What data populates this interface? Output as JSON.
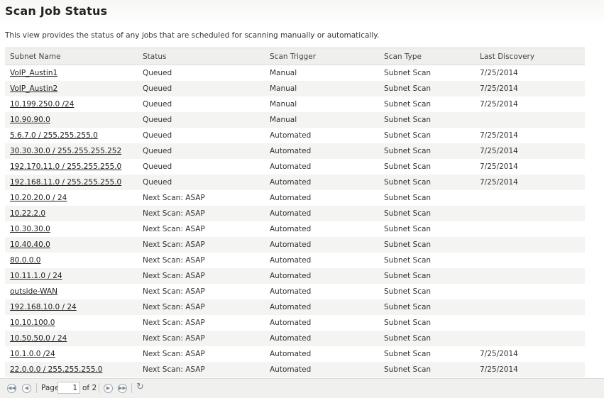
{
  "header": {
    "title": "Scan Job Status",
    "description": "This view provides the status of any jobs that are scheduled for scanning manually or automatically."
  },
  "table": {
    "columns": [
      "Subnet Name",
      "Status",
      "Scan Trigger",
      "Scan Type",
      "Last Discovery"
    ],
    "rows": [
      {
        "subnet": "VoIP_Austin1",
        "status": "Queued",
        "trigger": "Manual",
        "type": "Subnet Scan",
        "last": "7/25/2014"
      },
      {
        "subnet": "VoIP_Austin2",
        "status": "Queued",
        "trigger": "Manual",
        "type": "Subnet Scan",
        "last": "7/25/2014"
      },
      {
        "subnet": "10.199.250.0 /24",
        "status": "Queued",
        "trigger": "Manual",
        "type": "Subnet Scan",
        "last": "7/25/2014"
      },
      {
        "subnet": "10.90.90.0",
        "status": "Queued",
        "trigger": "Manual",
        "type": "Subnet Scan",
        "last": ""
      },
      {
        "subnet": "5.6.7.0 / 255.255.255.0",
        "status": "Queued",
        "trigger": "Automated",
        "type": "Subnet Scan",
        "last": "7/25/2014"
      },
      {
        "subnet": "30.30.30.0 / 255.255.255.252",
        "status": "Queued",
        "trigger": "Automated",
        "type": "Subnet Scan",
        "last": "7/25/2014"
      },
      {
        "subnet": "192.170.11.0 / 255.255.255.0",
        "status": "Queued",
        "trigger": "Automated",
        "type": "Subnet Scan",
        "last": "7/25/2014"
      },
      {
        "subnet": "192.168.11.0 / 255.255.255.0",
        "status": "Queued",
        "trigger": "Automated",
        "type": "Subnet Scan",
        "last": "7/25/2014"
      },
      {
        "subnet": "10.20.20.0 / 24",
        "status": "Next Scan: ASAP",
        "trigger": "Automated",
        "type": "Subnet Scan",
        "last": ""
      },
      {
        "subnet": "10.22.2.0",
        "status": "Next Scan: ASAP",
        "trigger": "Automated",
        "type": "Subnet Scan",
        "last": ""
      },
      {
        "subnet": "10.30.30.0",
        "status": "Next Scan: ASAP",
        "trigger": "Automated",
        "type": "Subnet Scan",
        "last": ""
      },
      {
        "subnet": "10.40.40.0",
        "status": "Next Scan: ASAP",
        "trigger": "Automated",
        "type": "Subnet Scan",
        "last": ""
      },
      {
        "subnet": "80.0.0.0",
        "status": "Next Scan: ASAP",
        "trigger": "Automated",
        "type": "Subnet Scan",
        "last": ""
      },
      {
        "subnet": "10.11.1.0 / 24",
        "status": "Next Scan: ASAP",
        "trigger": "Automated",
        "type": "Subnet Scan",
        "last": ""
      },
      {
        "subnet": "outside-WAN",
        "status": "Next Scan: ASAP",
        "trigger": "Automated",
        "type": "Subnet Scan",
        "last": ""
      },
      {
        "subnet": "192.168.10.0 / 24",
        "status": "Next Scan: ASAP",
        "trigger": "Automated",
        "type": "Subnet Scan",
        "last": ""
      },
      {
        "subnet": "10.10.100.0",
        "status": "Next Scan: ASAP",
        "trigger": "Automated",
        "type": "Subnet Scan",
        "last": ""
      },
      {
        "subnet": "10.50.50.0 / 24",
        "status": "Next Scan: ASAP",
        "trigger": "Automated",
        "type": "Subnet Scan",
        "last": ""
      },
      {
        "subnet": "10.1.0.0 /24",
        "status": "Next Scan: ASAP",
        "trigger": "Automated",
        "type": "Subnet Scan",
        "last": "7/25/2014"
      },
      {
        "subnet": "22.0.0.0 / 255.255.255.0",
        "status": "Next Scan: ASAP",
        "trigger": "Automated",
        "type": "Subnet Scan",
        "last": "7/25/2014"
      }
    ]
  },
  "pager": {
    "page_label": "Page",
    "current_page": "1",
    "of_label": "of 2",
    "icons": {
      "first": "first-page-icon",
      "prev": "previous-page-icon",
      "next": "next-page-icon",
      "last": "last-page-icon",
      "refresh": "refresh-icon"
    }
  }
}
